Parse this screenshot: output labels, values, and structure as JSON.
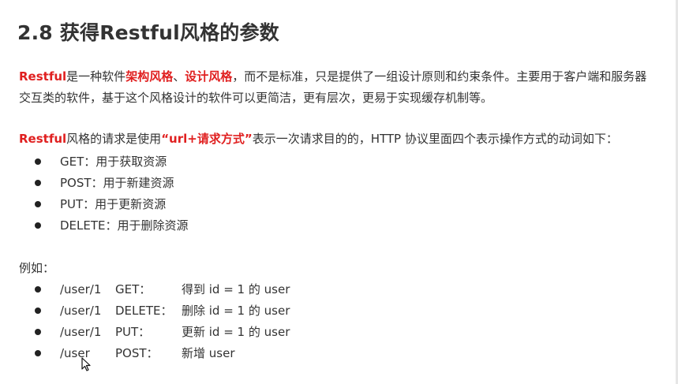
{
  "title": "2.8 获得Restful风格的参数",
  "intro": {
    "lead": "Restful",
    "t1": "是一种软件",
    "em1": "架构风格",
    "t2": "、",
    "em2": "设计风格",
    "t3": "，而不是标准，只是提供了一组设计原则和约束条件。主要用于客户端和服务器交互类的软件，基于这个风格设计的软件可以更简洁，更有层次，更易于实现缓存机制等。"
  },
  "request_desc": {
    "lead": "Restful",
    "t1": "风格的请求是使用",
    "em": "“url+请求方式”",
    "t2": "表示一次请求目的的，HTTP 协议里面四个表示操作方式的动词如下："
  },
  "verbs": [
    {
      "text": "GET：用于获取资源"
    },
    {
      "text": "POST：用于新建资源"
    },
    {
      "text": "PUT：用于更新资源"
    },
    {
      "text": "DELETE：用于删除资源"
    }
  ],
  "example_label": "例如：",
  "examples": [
    {
      "path": "/user/1",
      "method": "GET：",
      "desc": "得到 id = 1 的 user"
    },
    {
      "path": "/user/1",
      "method": "DELETE：",
      "desc": "删除 id = 1 的 user"
    },
    {
      "path": "/user/1",
      "method": "PUT：",
      "desc": "更新 id = 1 的 user"
    },
    {
      "path": "/user",
      "method": "POST：",
      "desc": "新增 user"
    }
  ]
}
